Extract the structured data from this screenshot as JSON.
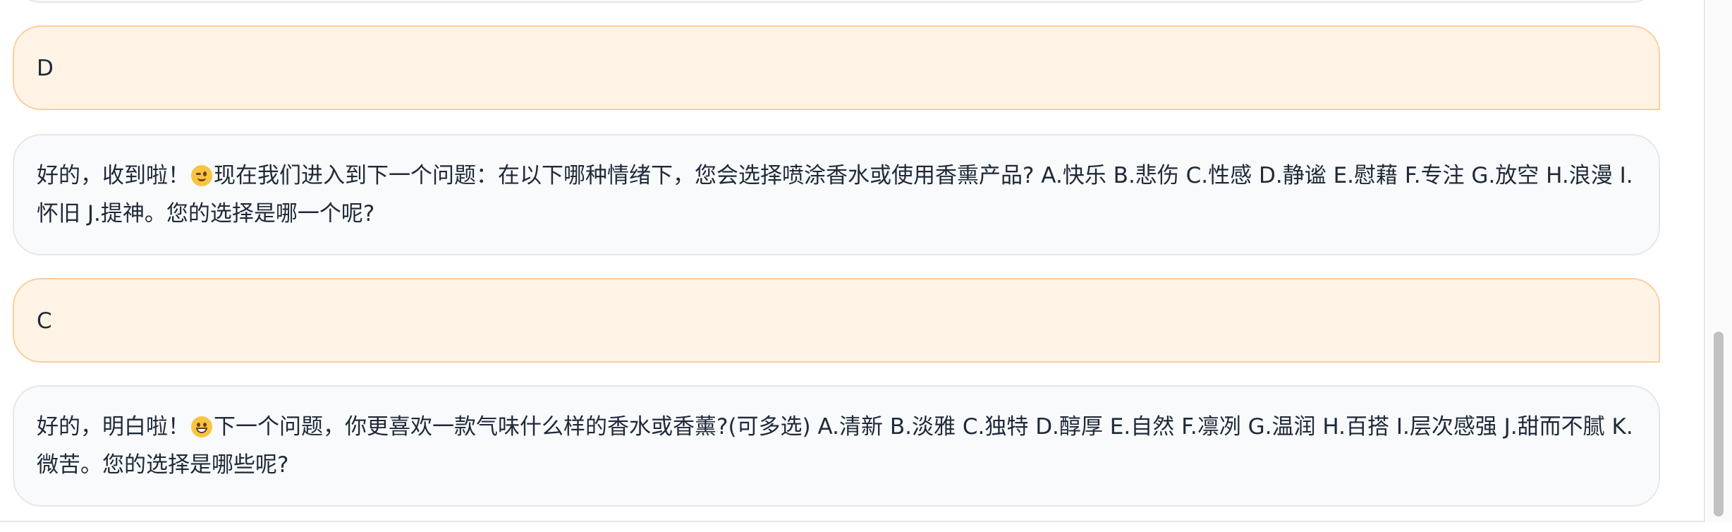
{
  "messages": [
    {
      "role": "user",
      "text": "D"
    },
    {
      "role": "bot",
      "text_before": "好的，收到啦！",
      "emoji": "winking-face",
      "text_after": "现在我们进入到下一个问题：在以下哪种情绪下，您会选择喷涂香水或使用香熏产品? A.快乐 B.悲伤 C.性感 D.静谧 E.慰藉 F.专注 G.放空 H.浪漫 I.怀旧 J.提神。您的选择是哪一个呢?"
    },
    {
      "role": "user",
      "text": "C"
    },
    {
      "role": "bot",
      "text_before": "好的，明白啦！",
      "emoji": "grinning-face",
      "text_after": "下一个问题，你更喜欢一款气味什么样的香水或香薰?(可多选) A.清新 B.淡雅 C.独特 D.醇厚 E.自然 F.凛冽 G.温润 H.百搭 I.层次感强 J.甜而不腻 K.微苦。您的选择是哪些呢?"
    }
  ],
  "colors": {
    "user_bubble_bg": "#fff3e6",
    "user_bubble_border": "#f8cf9c",
    "bot_bubble_bg": "#f8fafc",
    "bot_bubble_border": "#e5e7eb",
    "text": "#1f2937"
  }
}
